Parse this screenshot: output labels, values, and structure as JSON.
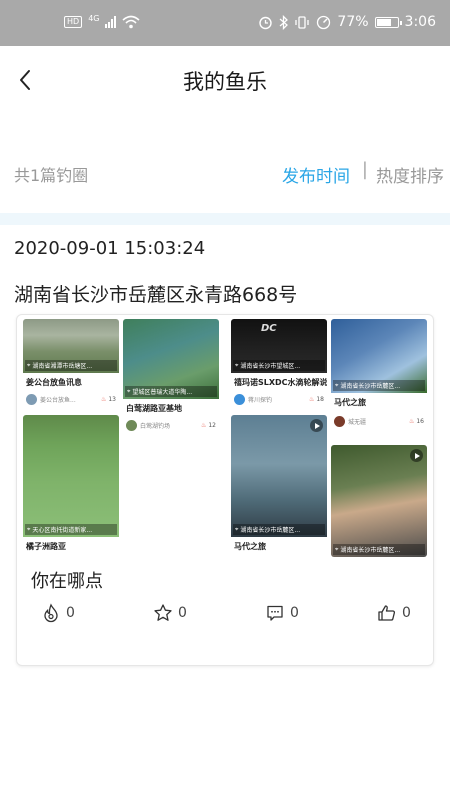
{
  "status_bar": {
    "hd": "HD",
    "net": "4G",
    "battery": "77%",
    "battery_level": 0.77,
    "time": "3:06"
  },
  "header": {
    "title": "我的鱼乐"
  },
  "subbar": {
    "count": "共1篇钓圈",
    "sort_time": "发布时间",
    "separator": "|",
    "sort_heat": "热度排序"
  },
  "post": {
    "time": "2020-09-01 15:03:24",
    "location": "湖南省长沙市岳麓区永青路668号",
    "text": "你在哪点",
    "tiles": [
      {
        "loc": "湖南省湘潭市岳塘区...",
        "title": "姜公台放鱼讯息",
        "author": "姜公台放鱼...",
        "fire": "13"
      },
      {
        "loc": "望城区普瑞大道华陶...",
        "title": "白莺湖路亚基地",
        "author": "白莺湖钓场",
        "fire": "12"
      },
      {
        "loc": "湖南省长沙市望城区...",
        "title": "禧玛诺SLXDC水滴轮解说",
        "author": "蒋川探钓",
        "fire": "18"
      },
      {
        "loc": "湖南省长沙市岳麓区...",
        "title": "马代之旅",
        "author": "城无疆",
        "fire": "16"
      },
      {
        "loc": "天心区南托街道新家...",
        "title": "橘子洲路亚"
      },
      {
        "loc": "湖南省长沙市岳麓区...",
        "title": "马代之旅"
      },
      {
        "loc": "湖南省长沙市岳麓区..."
      }
    ],
    "actions": {
      "fire": "0",
      "star": "0",
      "comment": "0",
      "like": "0"
    }
  },
  "colors": {
    "accent": "#2aa6e6",
    "status_bar": "#a9a9a9",
    "band": "#eef7fc"
  }
}
